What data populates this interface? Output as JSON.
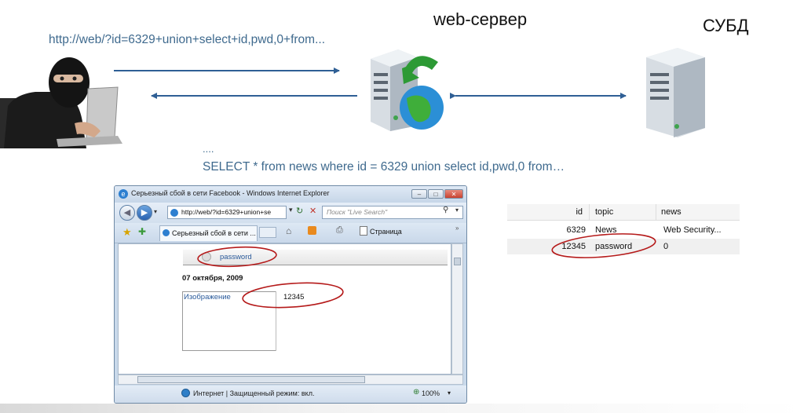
{
  "labels": {
    "request_url": "http://web/?id=6329+union+select+id,pwd,0+from...",
    "web_server": "web-сервер",
    "dbms": "СУБД",
    "sql_dots": "....",
    "sql_query": "SELECT * from news where id = 6329 union select id,pwd,0 from…"
  },
  "browser": {
    "title": "Серьезный сбой в сети Facebook - Windows Internet Explorer",
    "address": "http://web/?id=6329+union+se",
    "search_placeholder": "Поиск \"Live Search\"",
    "tab_label": "Серьезный сбой в сети ...",
    "page_menu": "Страница",
    "page": {
      "heading": "password",
      "date": "07 октября, 2009",
      "image_link": "Изображение",
      "value": "12345"
    },
    "status": "Интернет | Защищенный режим: вкл.",
    "zoom": "100%"
  },
  "db_table": {
    "columns": [
      "id",
      "topic",
      "news"
    ],
    "rows": [
      [
        "6329",
        "News",
        "Web Security..."
      ],
      [
        "12345",
        "password",
        "0"
      ]
    ]
  },
  "colors": {
    "arrow": "#2f5f95",
    "label_blue": "#3f6a8e",
    "highlight_ellipse": "#b51a1a"
  },
  "icons": [
    "hacker-image",
    "web-server-icon",
    "dbms-server-icon",
    "ie-logo-icon",
    "globe-icon"
  ]
}
